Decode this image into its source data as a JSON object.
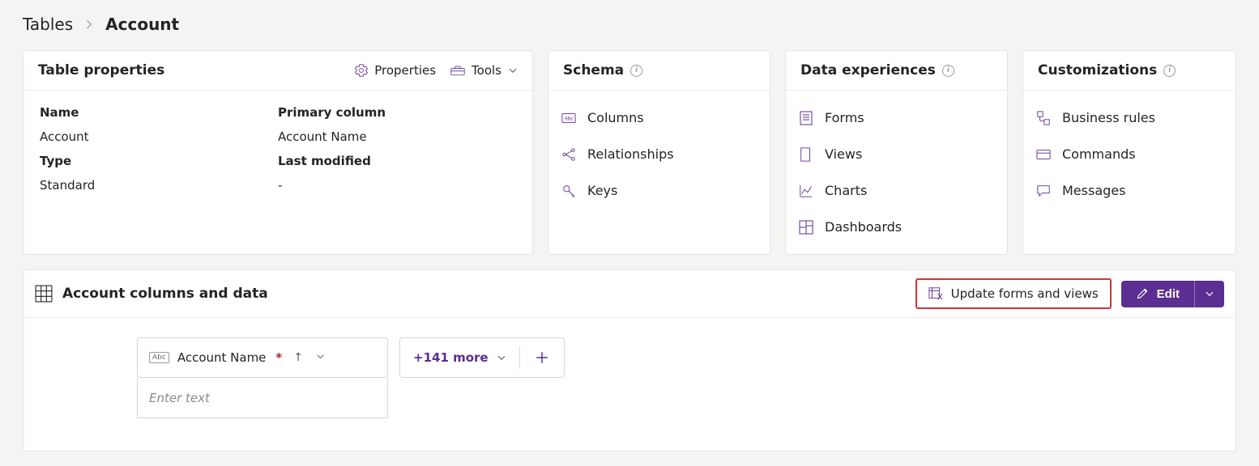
{
  "breadcrumb": {
    "root": "Tables",
    "current": "Account"
  },
  "cards": {
    "properties": {
      "title": "Table properties",
      "actions": {
        "properties": "Properties",
        "tools": "Tools"
      },
      "fields": {
        "name_label": "Name",
        "name_value": "Account",
        "primary_label": "Primary column",
        "primary_value": "Account Name",
        "type_label": "Type",
        "type_value": "Standard",
        "modified_label": "Last modified",
        "modified_value": "-"
      }
    },
    "schema": {
      "title": "Schema",
      "items": {
        "columns": "Columns",
        "relationships": "Relationships",
        "keys": "Keys"
      }
    },
    "data_experiences": {
      "title": "Data experiences",
      "items": {
        "forms": "Forms",
        "views": "Views",
        "charts": "Charts",
        "dashboards": "Dashboards"
      }
    },
    "customizations": {
      "title": "Customizations",
      "items": {
        "business_rules": "Business rules",
        "commands": "Commands",
        "messages": "Messages"
      }
    }
  },
  "bottom": {
    "title": "Account columns and data",
    "update_label": "Update forms and views",
    "edit_label": "Edit",
    "column_name": "Account Name",
    "more_label": "+141 more",
    "enter_placeholder": "Enter text"
  }
}
